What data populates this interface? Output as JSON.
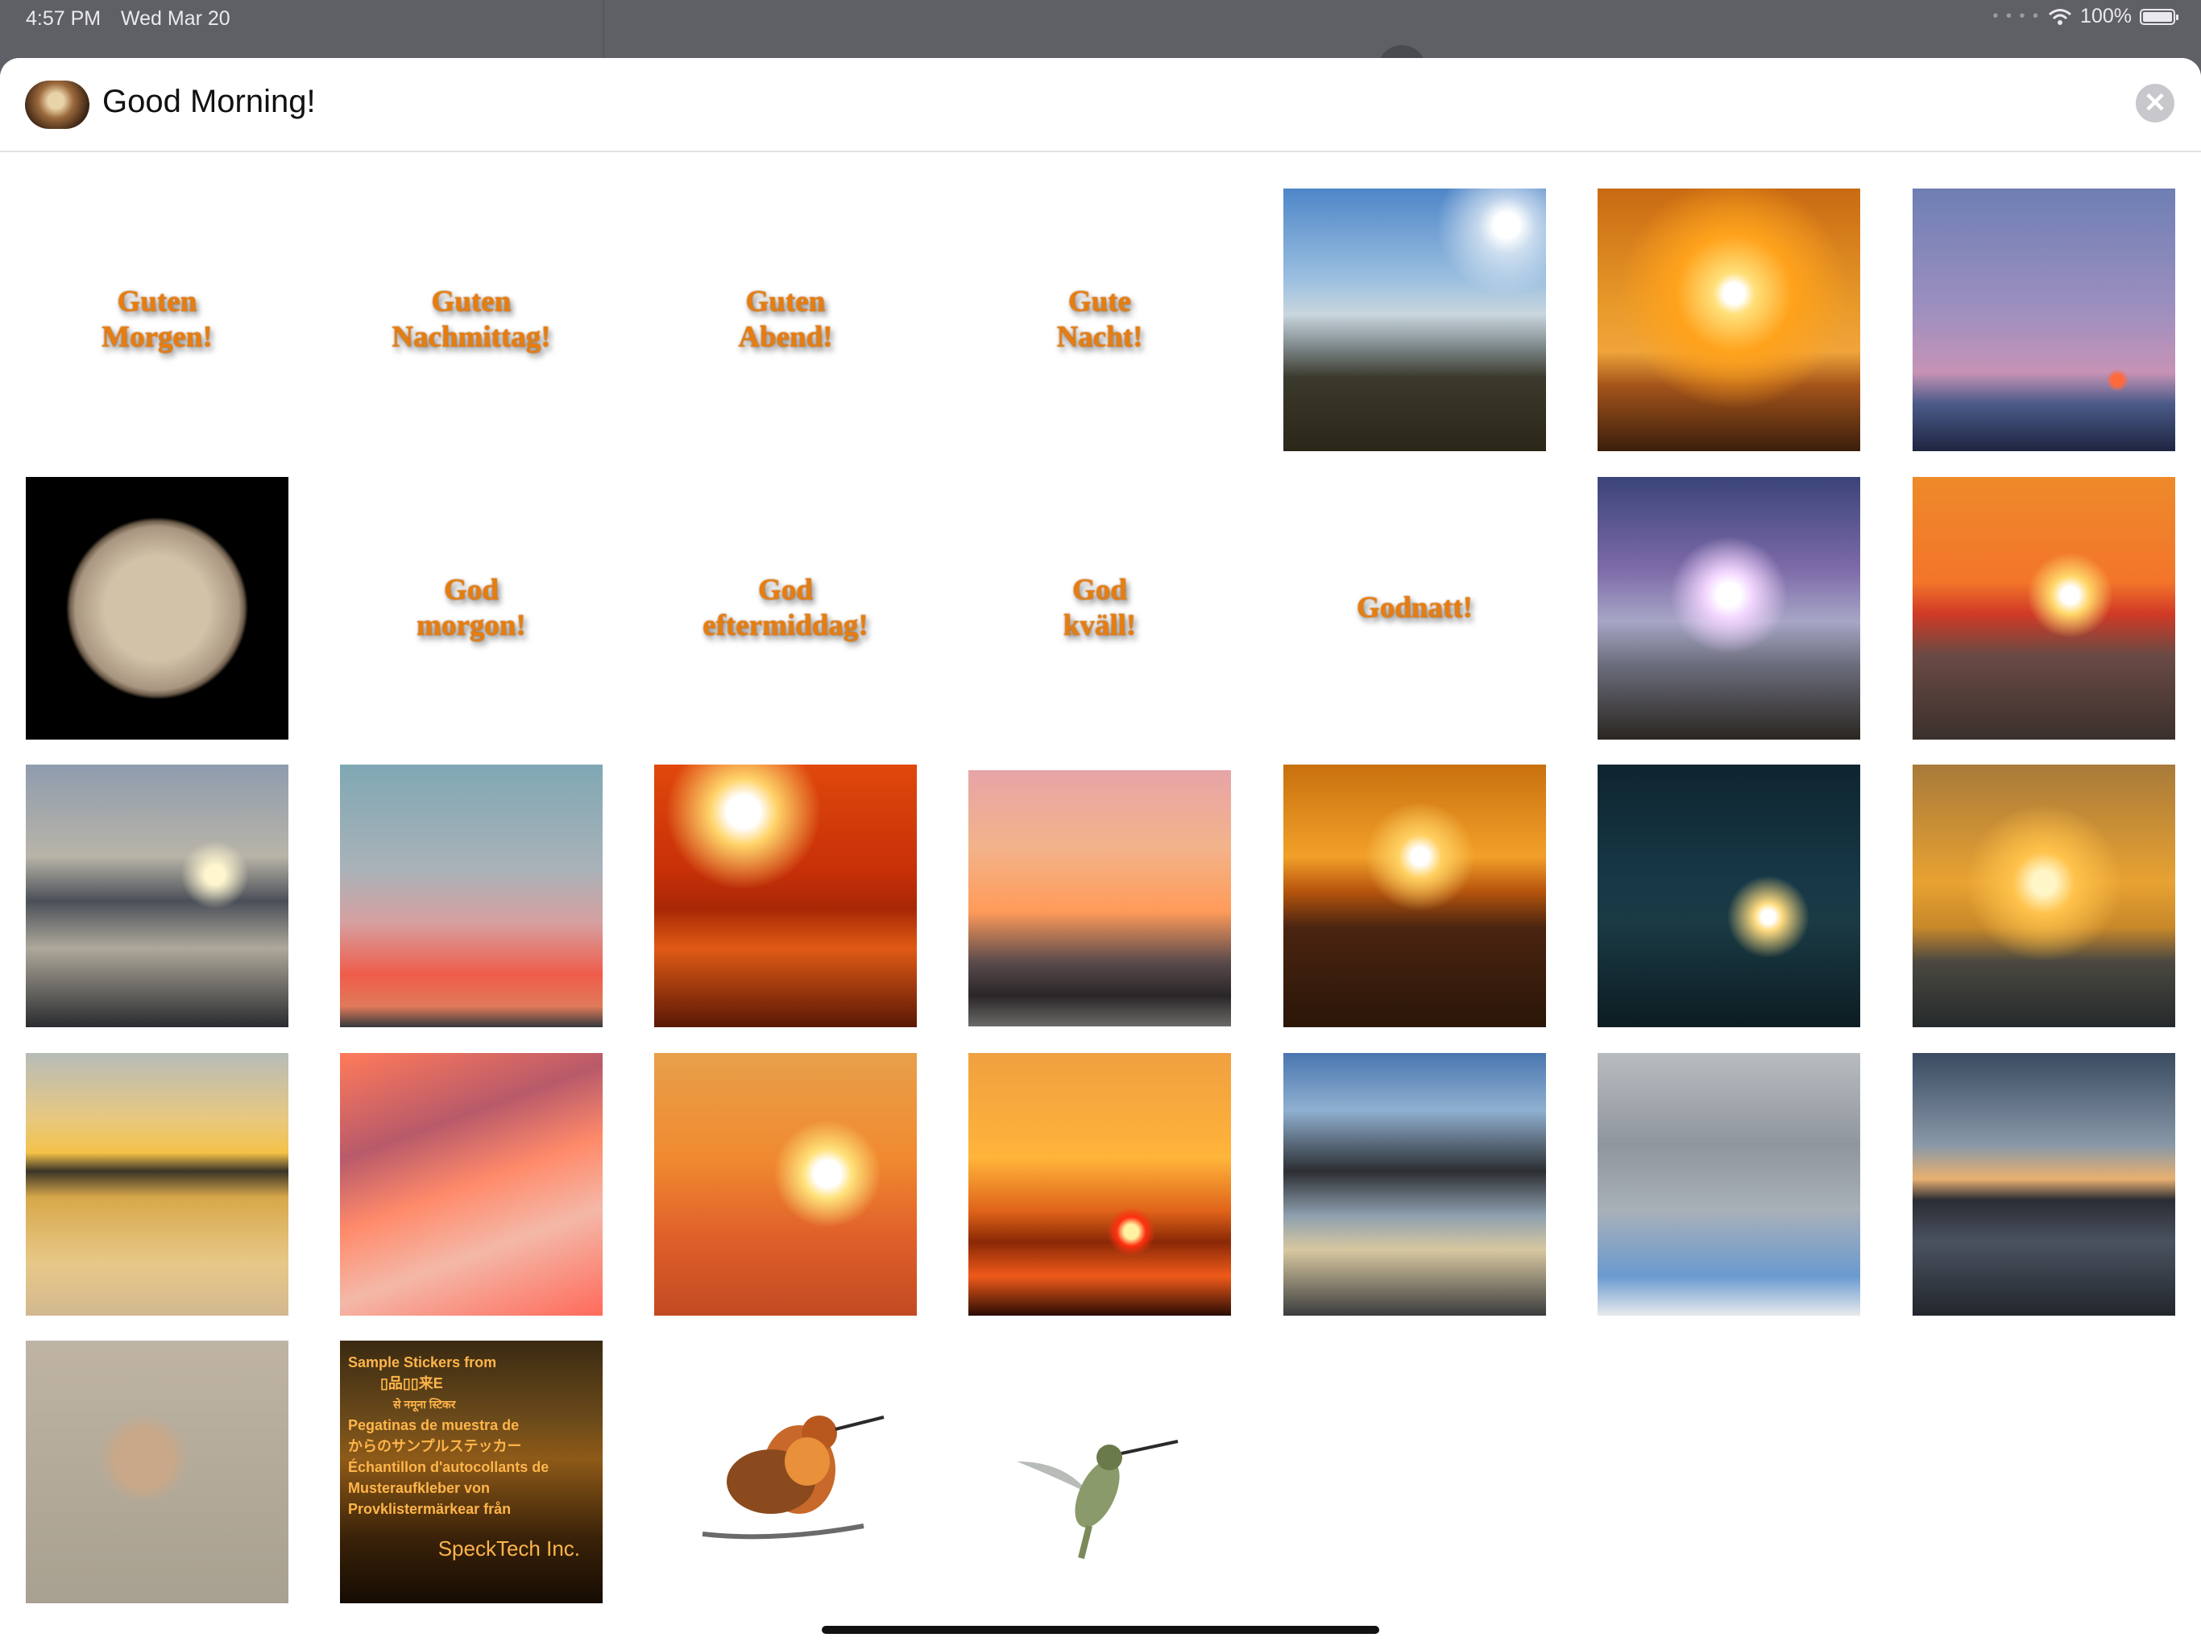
{
  "status_bar": {
    "time": "4:57 PM",
    "date": "Wed Mar 20",
    "battery": "100%"
  },
  "app": {
    "title": "Good Morning!"
  },
  "close_glyph": "✕",
  "stickers": {
    "row1": [
      "Guten\nMorgen!",
      "Guten\nNachmittag!",
      "Guten\nAbend!",
      "Gute\nNacht!"
    ],
    "row2": [
      "God\nmorgon!",
      "God\neftermiddag!",
      "God\nkväll!",
      "Godnatt!"
    ]
  },
  "promo": {
    "lines": [
      "Sample Stickers from",
      "▯品▯▯来E",
      "से नमूना स्टिकर",
      "Pegatinas de muestra de",
      "からのサンプルステッカー",
      "Échantillon d'autocollants de",
      "Musteraufkleber von",
      "Provklistermärkear från"
    ],
    "company": "SpeckTech Inc."
  },
  "colors": {
    "sheet_bg": "#ffffff",
    "text_sticker": "#e77d0e",
    "status_bg": "#5f6066"
  }
}
